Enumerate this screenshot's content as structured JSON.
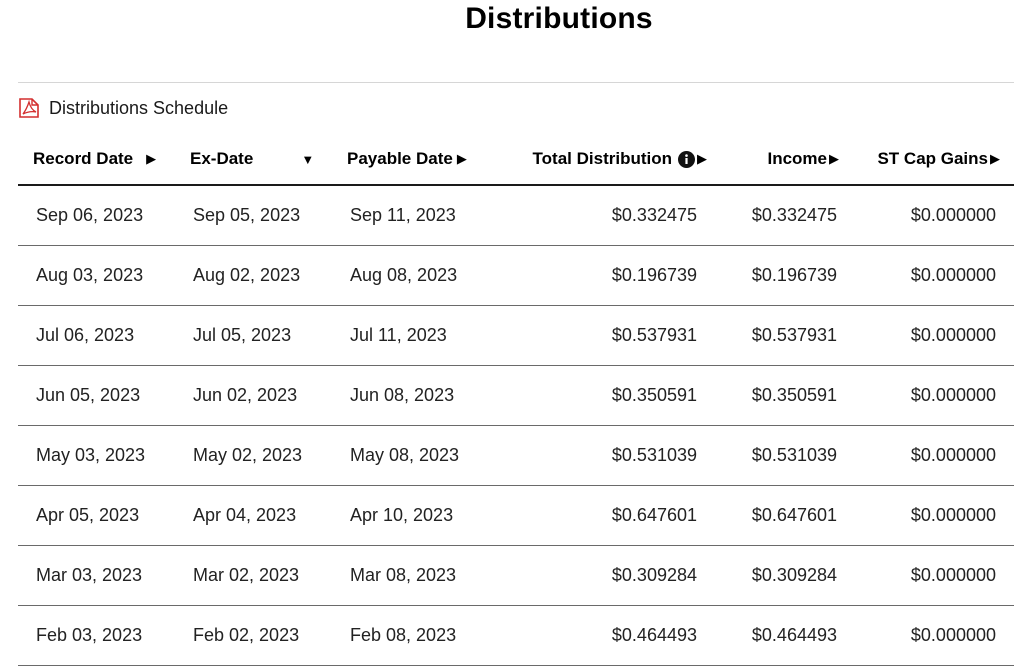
{
  "header": {
    "title": "Distributions"
  },
  "schedule_link": {
    "label": "Distributions Schedule",
    "icon": "pdf-icon"
  },
  "table": {
    "columns": [
      {
        "key": "record",
        "label": "Record Date",
        "sort_icon": "▶"
      },
      {
        "key": "ex",
        "label": "Ex-Date",
        "sort_icon": "▼"
      },
      {
        "key": "payable",
        "label": "Payable Date",
        "sort_icon": "▶"
      },
      {
        "key": "total",
        "label": "Total Distribution",
        "sort_icon": "▶",
        "info_icon": "info-icon"
      },
      {
        "key": "income",
        "label": "Income",
        "sort_icon": "▶"
      },
      {
        "key": "stcap",
        "label": "ST Cap Gains",
        "sort_icon": "▶"
      }
    ],
    "rows": [
      [
        "Sep 06, 2023",
        "Sep 05, 2023",
        "Sep 11, 2023",
        "$0.332475",
        "$0.332475",
        "$0.000000"
      ],
      [
        "Aug 03, 2023",
        "Aug 02, 2023",
        "Aug 08, 2023",
        "$0.196739",
        "$0.196739",
        "$0.000000"
      ],
      [
        "Jul 06, 2023",
        "Jul 05, 2023",
        "Jul 11, 2023",
        "$0.537931",
        "$0.537931",
        "$0.000000"
      ],
      [
        "Jun 05, 2023",
        "Jun 02, 2023",
        "Jun 08, 2023",
        "$0.350591",
        "$0.350591",
        "$0.000000"
      ],
      [
        "May 03, 2023",
        "May 02, 2023",
        "May 08, 2023",
        "$0.531039",
        "$0.531039",
        "$0.000000"
      ],
      [
        "Apr 05, 2023",
        "Apr 04, 2023",
        "Apr 10, 2023",
        "$0.647601",
        "$0.647601",
        "$0.000000"
      ],
      [
        "Mar 03, 2023",
        "Mar 02, 2023",
        "Mar 08, 2023",
        "$0.309284",
        "$0.309284",
        "$0.000000"
      ],
      [
        "Feb 03, 2023",
        "Feb 02, 2023",
        "Feb 08, 2023",
        "$0.464493",
        "$0.464493",
        "$0.000000"
      ]
    ]
  },
  "colors": {
    "pdf_red": "#d32f2f",
    "text": "#1a1a1a",
    "rule": "#6a6a6a"
  }
}
